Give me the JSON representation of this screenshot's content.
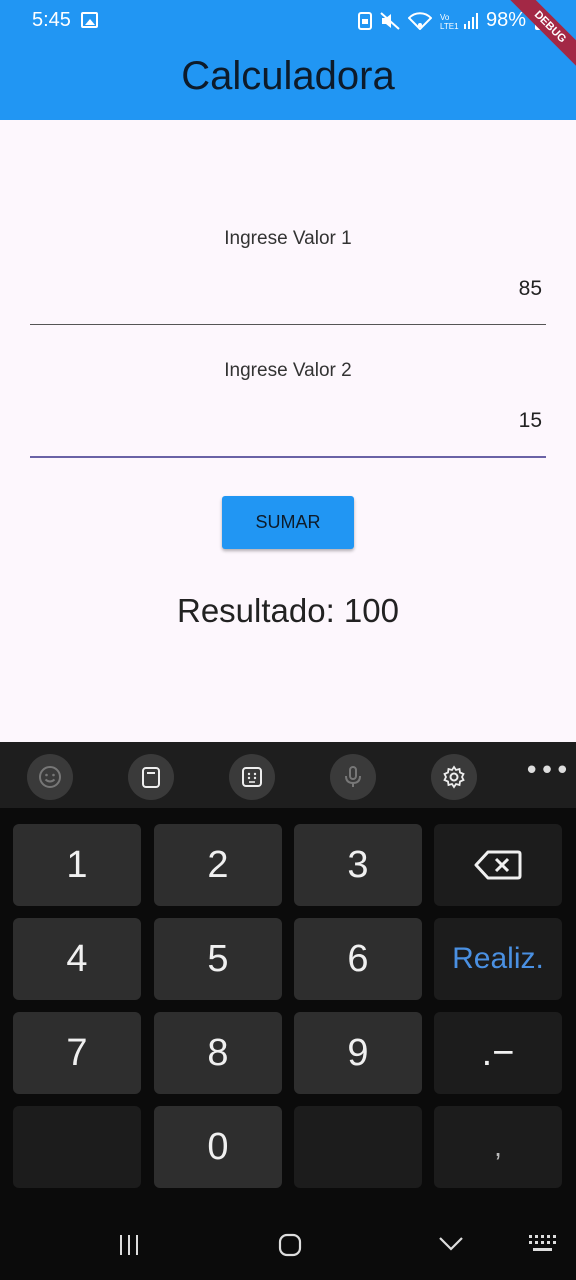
{
  "status_bar": {
    "time": "5:45",
    "battery": "98%"
  },
  "app": {
    "title": "Calculadora",
    "debug_banner": "DEBUG"
  },
  "form": {
    "field1": {
      "label": "Ingrese Valor 1",
      "value": "85"
    },
    "field2": {
      "label": "Ingrese Valor 2",
      "value": "15"
    },
    "button_label": "SUMAR",
    "result_text": "Resultado: 100"
  },
  "keyboard": {
    "toolbar_icons": [
      "emoji-icon",
      "clipboard-icon",
      "keypad-icon",
      "microphone-icon",
      "settings-icon",
      "more-icon"
    ],
    "keys": {
      "k1": "1",
      "k2": "2",
      "k3": "3",
      "k4": "4",
      "k5": "5",
      "k6": "6",
      "k7": "7",
      "k8": "8",
      "k9": "9",
      "k0": "0",
      "done": "Realiz.",
      "dot_minus": ".−",
      "comma": ","
    }
  },
  "colors": {
    "primary": "#2196f3",
    "background": "#fdf7fd",
    "active_underline": "#6a62a6",
    "done_key_text": "#4a90e2"
  }
}
